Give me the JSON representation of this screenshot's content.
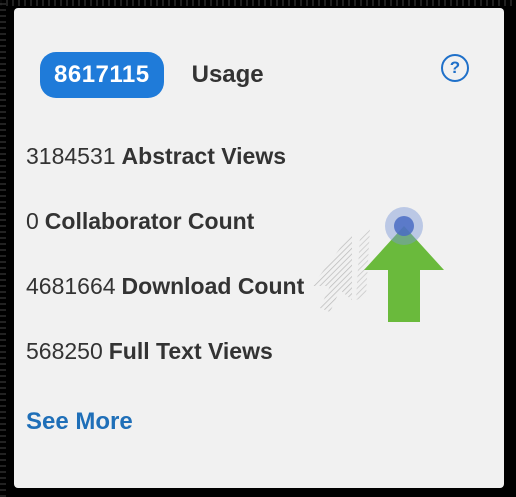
{
  "usage": {
    "total": "8617115",
    "title": "Usage",
    "help_glyph": "?"
  },
  "metrics": [
    {
      "value": "3184531",
      "label": "Abstract Views"
    },
    {
      "value": "0",
      "label": "Collaborator Count"
    },
    {
      "value": "4681664",
      "label": "Download Count"
    },
    {
      "value": "568250",
      "label": "Full Text Views"
    }
  ],
  "links": {
    "see_more": "See More"
  },
  "colors": {
    "badge": "#1f7bd9",
    "link": "#1f6fb8",
    "panel_bg": "#f1f1f1",
    "arrow": "#6aba3c",
    "click_dot": "#6f8fd8"
  },
  "overlay": {
    "pointer_icon": "cursor-arrow-icon",
    "arrow_icon": "up-arrow-icon",
    "click_icon": "click-indicator-icon"
  }
}
